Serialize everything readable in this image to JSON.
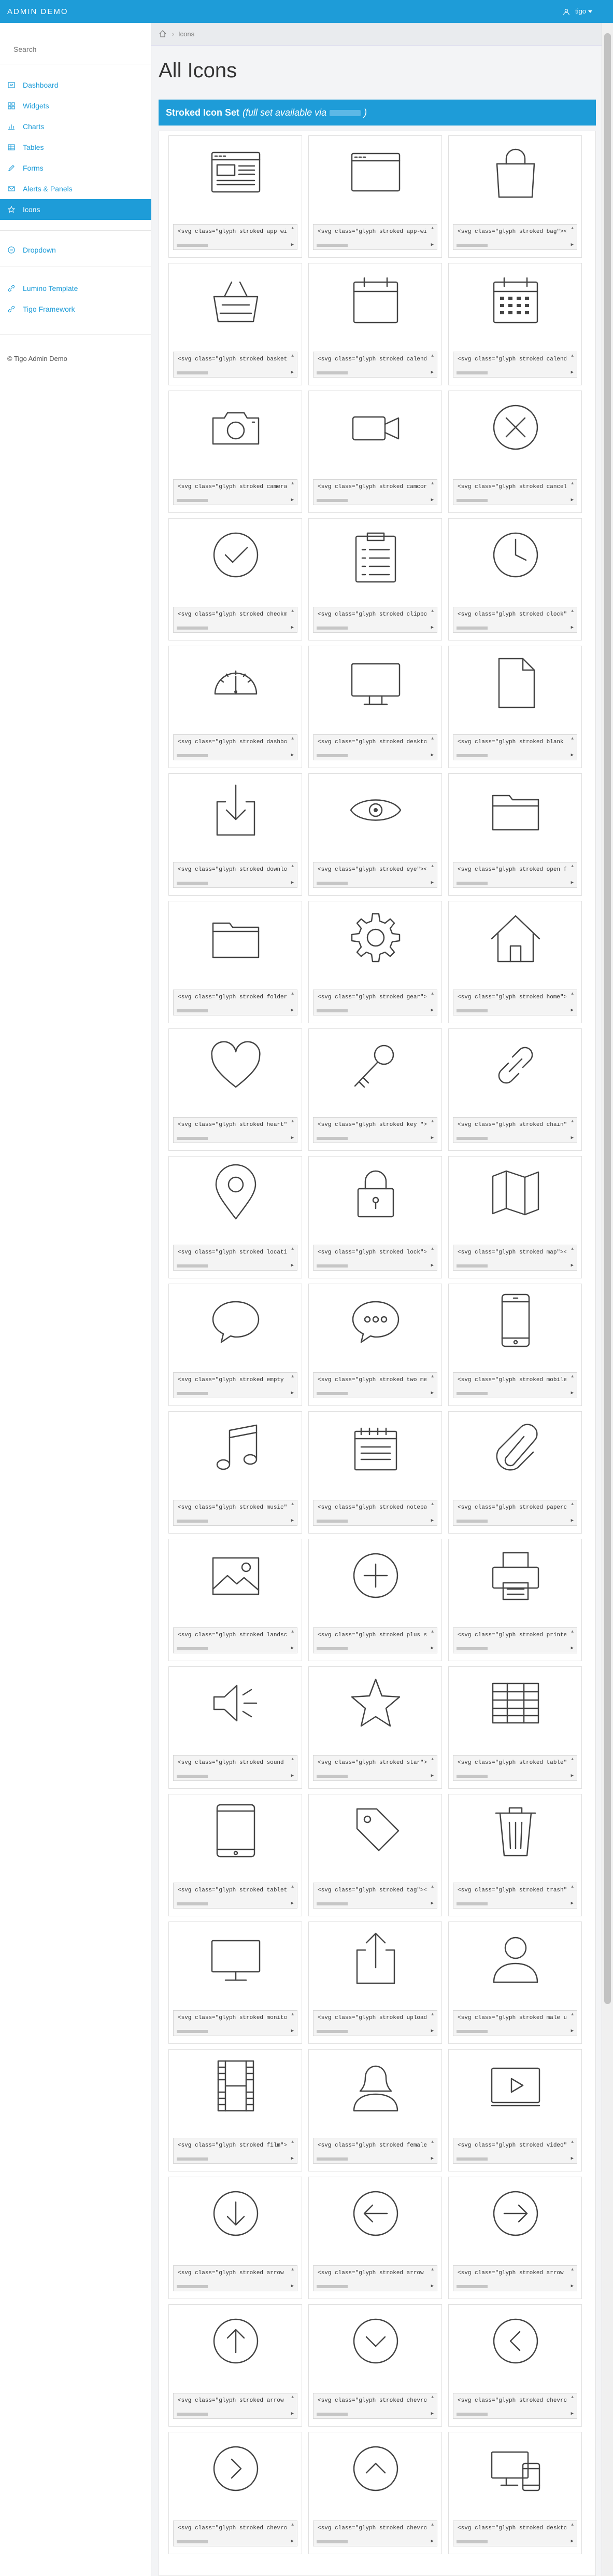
{
  "app": {
    "brand": "ADMIN DEMO",
    "user": "tigo"
  },
  "search": {
    "placeholder": "Search"
  },
  "nav": [
    {
      "label": "Dashboard",
      "icon": "dashboard-icon"
    },
    {
      "label": "Widgets",
      "icon": "widgets-icon"
    },
    {
      "label": "Charts",
      "icon": "charts-icon"
    },
    {
      "label": "Tables",
      "icon": "tables-icon"
    },
    {
      "label": "Forms",
      "icon": "pencil-icon"
    },
    {
      "label": "Alerts & Panels",
      "icon": "envelope-icon"
    },
    {
      "label": "Icons",
      "icon": "star-icon",
      "active": true
    }
  ],
  "nav2": [
    {
      "label": "Dropdown",
      "icon": "circle-icon"
    }
  ],
  "nav3": [
    {
      "label": "Lumino Template",
      "icon": "link-icon"
    },
    {
      "label": "Tigo Framework",
      "icon": "link-icon"
    }
  ],
  "footer": {
    "copyright": "© Tigo Admin Demo"
  },
  "breadcrumb": {
    "current": "Icons"
  },
  "page": {
    "title": "All Icons"
  },
  "banner": {
    "title": "Stroked Icon Set",
    "subtitle": "(full set available via"
  },
  "icons": [
    {
      "name": "app-window-with-content",
      "code": "<svg class=\"glyph stroked app window with content\">"
    },
    {
      "name": "app-window",
      "code": "<svg class=\"glyph stroked app-window\"><use"
    },
    {
      "name": "bag",
      "code": "<svg class=\"glyph stroked bag\"><use xlink:h"
    },
    {
      "name": "basket",
      "code": "<svg class=\"glyph stroked basket \"><use xl"
    },
    {
      "name": "calendar",
      "code": "<svg class=\"glyph stroked calendar\"><use"
    },
    {
      "name": "calendar-blank",
      "code": "<svg class=\"glyph stroked calendar blank"
    },
    {
      "name": "camera",
      "code": "<svg class=\"glyph stroked camera \"><use xl"
    },
    {
      "name": "camcorder",
      "code": "<svg class=\"glyph stroked camcorder\"><use"
    },
    {
      "name": "cancel",
      "code": "<svg class=\"glyph stroked cancel\"><use xl"
    },
    {
      "name": "checkmark",
      "code": "<svg class=\"glyph stroked checkmark\"><use"
    },
    {
      "name": "clipboard",
      "code": "<svg class=\"glyph stroked clipboard with"
    },
    {
      "name": "clock",
      "code": "<svg class=\"glyph stroked clock\"><use xli"
    },
    {
      "name": "dashboard-dial",
      "code": "<svg class=\"glyph stroked dashboard dial"
    },
    {
      "name": "desktop",
      "code": "<svg class=\"glyph stroked desktop\"><use x"
    },
    {
      "name": "blank-document",
      "code": "<svg class=\"glyph stroked blank documen"
    },
    {
      "name": "download",
      "code": "<svg class=\"glyph stroked download\"><use"
    },
    {
      "name": "eye",
      "code": "<svg class=\"glyph stroked eye\"><use xlink:h"
    },
    {
      "name": "open-folder",
      "code": "<svg class=\"glyph stroked open folder\">"
    },
    {
      "name": "folder",
      "code": "<svg class=\"glyph stroked folder\"><use xl"
    },
    {
      "name": "gear",
      "code": "<svg class=\"glyph stroked gear\"><use xlink:"
    },
    {
      "name": "home",
      "code": "<svg class=\"glyph stroked home\"><use xlink:"
    },
    {
      "name": "heart",
      "code": "<svg class=\"glyph stroked heart\"><use xlin"
    },
    {
      "name": "key",
      "code": "<svg class=\"glyph stroked key \"><use xlink:"
    },
    {
      "name": "chain",
      "code": "<svg class=\"glyph stroked chain\"><use xlin"
    },
    {
      "name": "location-pin",
      "code": "<svg class=\"glyph stroked location pin\">"
    },
    {
      "name": "lock",
      "code": "<svg class=\"glyph stroked lock\"><use xlink:"
    },
    {
      "name": "map",
      "code": "<svg class=\"glyph stroked map\"><use xlink:h"
    },
    {
      "name": "empty-message",
      "code": "<svg class=\"glyph stroked empty message\""
    },
    {
      "name": "two-messages",
      "code": "<svg class=\"glyph stroked two messages\">"
    },
    {
      "name": "mobile-device",
      "code": "<svg class=\"glyph stroked mobile device\""
    },
    {
      "name": "music",
      "code": "<svg class=\"glyph stroked music\"><use xlin"
    },
    {
      "name": "notepad",
      "code": "<svg class=\"glyph stroked notepad \"><use"
    },
    {
      "name": "paperclip",
      "code": "<svg class=\"glyph stroked paperclip\"><use"
    },
    {
      "name": "landscape",
      "code": "<svg class=\"glyph stroked landscape\"><use"
    },
    {
      "name": "plus-sign",
      "code": "<svg class=\"glyph stroked plus sign\"><use"
    },
    {
      "name": "printer",
      "code": "<svg class=\"glyph stroked printer\"><use x"
    },
    {
      "name": "sound-on",
      "code": "<svg class=\"glyph stroked sound on\"><use"
    },
    {
      "name": "star",
      "code": "<svg class=\"glyph stroked star\"><use xlink:"
    },
    {
      "name": "table",
      "code": "<svg class=\"glyph stroked table\"><use xlin"
    },
    {
      "name": "tablet",
      "code": "<svg class=\"glyph stroked tablet\"><use xli"
    },
    {
      "name": "tag",
      "code": "<svg class=\"glyph stroked tag\"><use xlink:h"
    },
    {
      "name": "trash",
      "code": "<svg class=\"glyph stroked trash\"><use xlin"
    },
    {
      "name": "monitor",
      "code": "<svg class=\"glyph stroked monitor\"><use x"
    },
    {
      "name": "upload",
      "code": "<svg class=\"glyph stroked upload\"><use xli"
    },
    {
      "name": "male-user",
      "code": "<svg class=\"glyph stroked male user \"><us"
    },
    {
      "name": "film",
      "code": "<svg class=\"glyph stroked film\"><use xlink:"
    },
    {
      "name": "female-user",
      "code": "<svg class=\"glyph stroked female user\"><u"
    },
    {
      "name": "video",
      "code": "<svg class=\"glyph stroked video\"><use xlin"
    },
    {
      "name": "arrow-down",
      "code": "<svg class=\"glyph stroked arrow down\"><u"
    },
    {
      "name": "arrow-left",
      "code": "<svg class=\"glyph stroked arrow left\"><u"
    },
    {
      "name": "arrow-right",
      "code": "<svg class=\"glyph stroked arrow right\"><"
    },
    {
      "name": "arrow-up",
      "code": "<svg class=\"glyph stroked arrow up\"><use"
    },
    {
      "name": "chevron-down",
      "code": "<svg class=\"glyph stroked chevron down\">"
    },
    {
      "name": "chevron-left",
      "code": "<svg class=\"glyph stroked chevron left\">"
    },
    {
      "name": "chevron-right",
      "code": "<svg class=\"glyph stroked chevron right\""
    },
    {
      "name": "chevron-up",
      "code": "<svg class=\"glyph stroked chevron up\"><u"
    },
    {
      "name": "desktop-computer-and-mobile",
      "code": "<svg class=\"glyph stroked desktop comput"
    }
  ]
}
